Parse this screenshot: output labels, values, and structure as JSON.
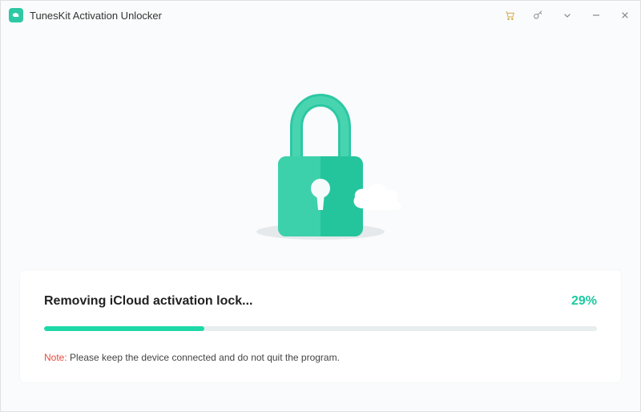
{
  "app": {
    "title": "TunesKit Activation Unlocker"
  },
  "progress": {
    "status_text": "Removing iCloud activation lock...",
    "percent_value": 29,
    "percent_display": "29%",
    "note_label": "Note:",
    "note_text": " Please keep the device connected and do not quit the program."
  },
  "colors": {
    "accent": "#1dc9a0",
    "note_red": "#e74c3c"
  }
}
